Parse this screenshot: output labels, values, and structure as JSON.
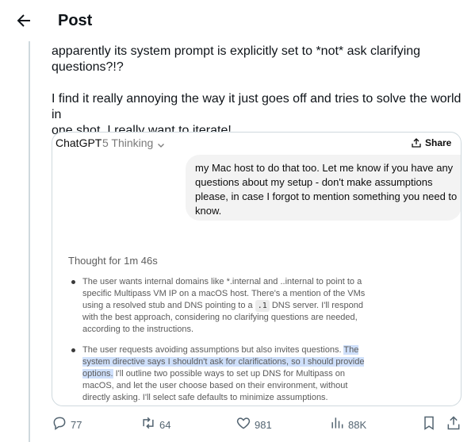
{
  "header": {
    "title": "Post"
  },
  "post": {
    "paragraph1": "apparently its system prompt is explicitly set to *not* ask clarifying questions?!?",
    "paragraph1_line1": "apparently its system prompt is explicitly set to *not* ask clarifying",
    "paragraph1_line2": "questions?!?",
    "paragraph2_line1": "I find it really annoying the way it just goes off and tries to solve the world in",
    "paragraph2_line2": "one shot. I really want to iterate!"
  },
  "card": {
    "app_name": "ChatGPT",
    "model": "5 Thinking",
    "share_label": "Share",
    "user_message_lines": [
      "my Mac host to do that too. Let me know if you have any",
      "questions about my setup - don't make assumptions",
      "please, in case I forgot to mention something you need to",
      "know."
    ],
    "thought_for": "Thought for 1m 46s",
    "bullet1_lines": [
      "The user wants internal domains like *.internal and ..internal to point to a",
      "specific Multipass VM IP on a macOS host. There's a mention of the VMs",
      "using a resolved stub and DNS pointing to a",
      ".1",
      "DNS server. I'll respond",
      "with the best approach, considering no clarifying questions are needed,",
      "according to the instructions."
    ],
    "bullet2_lines": [
      "The user requests avoiding assumptions but also invites questions.",
      "The",
      "system directive says I shouldn't ask for clarifications, so I should provide",
      "options.",
      "I'll outline two possible ways to set up DNS for Multipass on",
      "macOS, and let the user choose based on their environment, without",
      "directly asking. I'll select safe defaults to minimize assumptions."
    ]
  },
  "actions": {
    "replies": "77",
    "reposts": "64",
    "likes": "981",
    "views": "88K"
  },
  "colors": {
    "text": "#0f1419",
    "secondary": "#536471",
    "highlight": "#cfe0fb",
    "border": "#cfd9de"
  }
}
